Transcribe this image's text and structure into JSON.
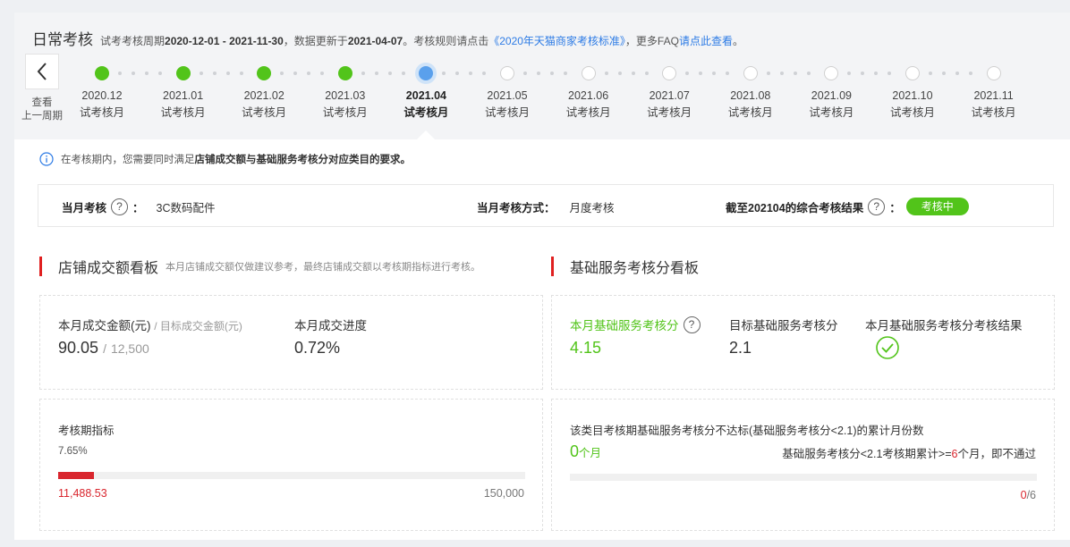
{
  "header": {
    "title": "日常考核",
    "period_prefix": "试考考核周期",
    "period": "2020-12-01 - 2021-11-30",
    "update_prefix": "，数据更新于",
    "update_date": "2021-04-07",
    "rules_prefix": "。考核规则请点击",
    "rules_link": "《2020年天猫商家考核标准》",
    "faq_prefix": "，更多FAQ",
    "faq_link": "请点此查看",
    "faq_suffix": "。"
  },
  "back": {
    "label_line1": "查看",
    "label_line2": "上一周期"
  },
  "timeline": [
    {
      "month": "2020.12",
      "status_label": "试考核月",
      "state": "done"
    },
    {
      "month": "2021.01",
      "status_label": "试考核月",
      "state": "done"
    },
    {
      "month": "2021.02",
      "status_label": "试考核月",
      "state": "done"
    },
    {
      "month": "2021.03",
      "status_label": "试考核月",
      "state": "done"
    },
    {
      "month": "2021.04",
      "status_label": "试考核月",
      "state": "current"
    },
    {
      "month": "2021.05",
      "status_label": "试考核月",
      "state": "future"
    },
    {
      "month": "2021.06",
      "status_label": "试考核月",
      "state": "future"
    },
    {
      "month": "2021.07",
      "status_label": "试考核月",
      "state": "future"
    },
    {
      "month": "2021.08",
      "status_label": "试考核月",
      "state": "future"
    },
    {
      "month": "2021.09",
      "status_label": "试考核月",
      "state": "future"
    },
    {
      "month": "2021.10",
      "status_label": "试考核月",
      "state": "future"
    },
    {
      "month": "2021.11",
      "status_label": "试考核月",
      "state": "future"
    }
  ],
  "info": {
    "prefix": "在考核期内，您需要同时满足",
    "bold": "店铺成交额与基础服务考核分对应类目的要求。"
  },
  "summary": {
    "monthly_label": "当月考核",
    "monthly_colon": "：",
    "category": "3C数码配件",
    "method_label": "当月考核方式：",
    "method_value": "月度考核",
    "result_label": "截至202104的综合考核结果",
    "result_colon": "：",
    "result_badge": "考核中"
  },
  "sales": {
    "title": "店铺成交额看板",
    "note": "本月店铺成交额仅做建议参考，最终店铺成交额以考核期指标进行考核。",
    "amount_label": "本月成交金额(元)",
    "target_label": "/ 目标成交金额(元)",
    "amount_value": "90.05",
    "target_value": "12,500",
    "progress_label": "本月成交进度",
    "progress_value": "0.72%",
    "period_label": "考核期指标",
    "period_percent": "7.65%",
    "period_fraction": 0.0765,
    "period_current": "11,488.53",
    "period_target": "150,000"
  },
  "service": {
    "title": "基础服务考核分看板",
    "score_label": "本月基础服务考核分",
    "score_value": "4.15",
    "target_label": "目标基础服务考核分",
    "target_value": "2.1",
    "result_label": "本月基础服务考核分考核结果",
    "fail_title": "该类目考核期基础服务考核分不达标(基础服务考核分<2.1)的累计月份数",
    "fail_count": "0",
    "fail_unit": "个月",
    "rule_prefix": "基础服务考核分<2.1考核期累计>=",
    "rule_num": "6",
    "rule_suffix": "个月，即不通过",
    "counter_current": "0",
    "counter_total": "/6",
    "counter_fraction": 0
  },
  "icons": {
    "back": "chevron-left-icon",
    "info": "info-circle-icon",
    "help": "question-circle-icon",
    "pass": "check-circle-icon"
  },
  "colors": {
    "green": "#52c41a",
    "red": "#d9262e",
    "link": "#2d7be5",
    "current": "#5aa0ec"
  }
}
